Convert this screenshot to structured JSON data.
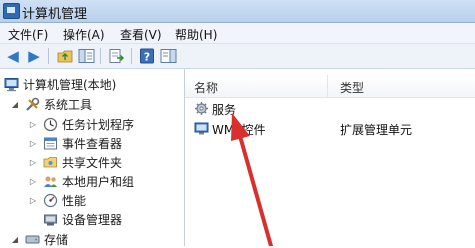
{
  "window": {
    "title": "计算机管理"
  },
  "menu": {
    "file": "文件(F)",
    "action": "操作(A)",
    "view": "查看(V)",
    "help": "帮助(H)"
  },
  "tree": {
    "root": "计算机管理(本地)",
    "system_tools": "系统工具",
    "task_scheduler": "任务计划程序",
    "event_viewer": "事件查看器",
    "shared_folders": "共享文件夹",
    "local_users": "本地用户和组",
    "performance": "性能",
    "device_manager": "设备管理器",
    "storage": "存储"
  },
  "list": {
    "columns": {
      "name": "名称",
      "type": "类型"
    },
    "rows": [
      {
        "name": "服务",
        "type": ""
      },
      {
        "name": "WMI 控件",
        "type": "扩展管理单元"
      }
    ]
  },
  "colors": {
    "arrow": "#d9302c",
    "accent": "#2f78c9"
  }
}
